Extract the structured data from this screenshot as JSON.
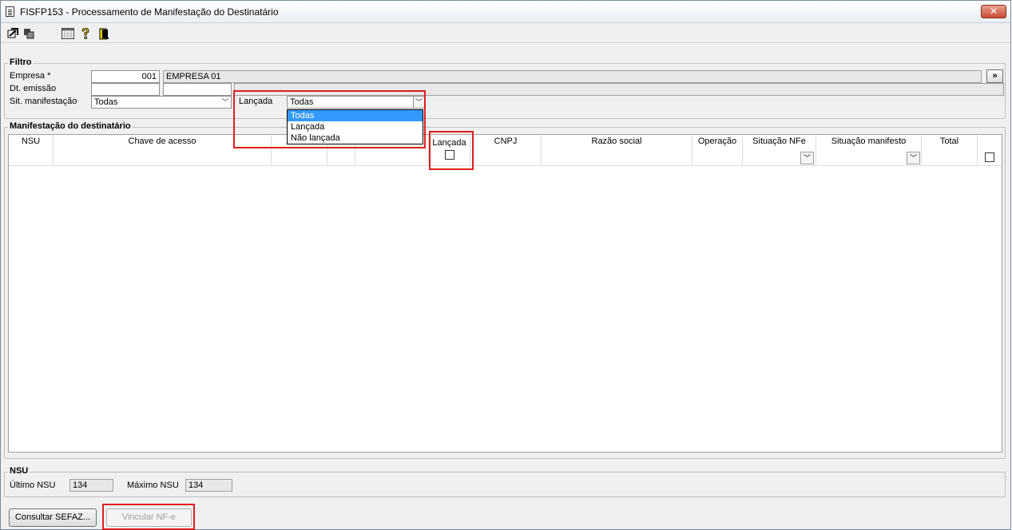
{
  "window": {
    "title": "FISFP153 - Processamento de Manifestação do Destinatário",
    "close_label": "✕"
  },
  "toolbar": {
    "icons": [
      "export-icon",
      "copy-icon",
      "calendar-grid-icon",
      "help-icon",
      "exit-door-icon"
    ]
  },
  "filtro": {
    "group_label": "Filtro",
    "empresa_label": "Empresa *",
    "empresa_code": "001",
    "empresa_name": "EMPRESA 01",
    "expand_label": "»",
    "dt_emissao_label": "Dt. emissão",
    "dt_emissao_from": "",
    "dt_emissao_to": "",
    "sit_manifestacao_label": "Sit. manifestação",
    "sit_manifestacao_value": "Todas",
    "lancada_label": "Lançada",
    "lancada_value": "Todas",
    "lancada_options": [
      "Todas",
      "Lançada",
      "Não lançada"
    ]
  },
  "manifestacao": {
    "group_label": "Manifestação do destinatário",
    "columns": {
      "nsu": "NSU",
      "chave": "Chave de acesso",
      "lancada": "Lançada",
      "cnpj": "CNPJ",
      "razao": "Razão social",
      "operacao": "Operação",
      "situacao_nfe": "Situação NFe",
      "situacao_manifesto": "Situação manifesto",
      "total": "Total"
    },
    "rows": []
  },
  "nsu": {
    "group_label": "NSU",
    "ultimo_label": "Último NSU",
    "ultimo_value": "134",
    "maximo_label": "Máximo NSU",
    "maximo_value": "134"
  },
  "buttons": {
    "consultar": "Consultar SEFAZ...",
    "vincular": "Vincular NF-e"
  },
  "colors": {
    "highlight_border": "#e01e1e",
    "selection": "#3399ff"
  }
}
